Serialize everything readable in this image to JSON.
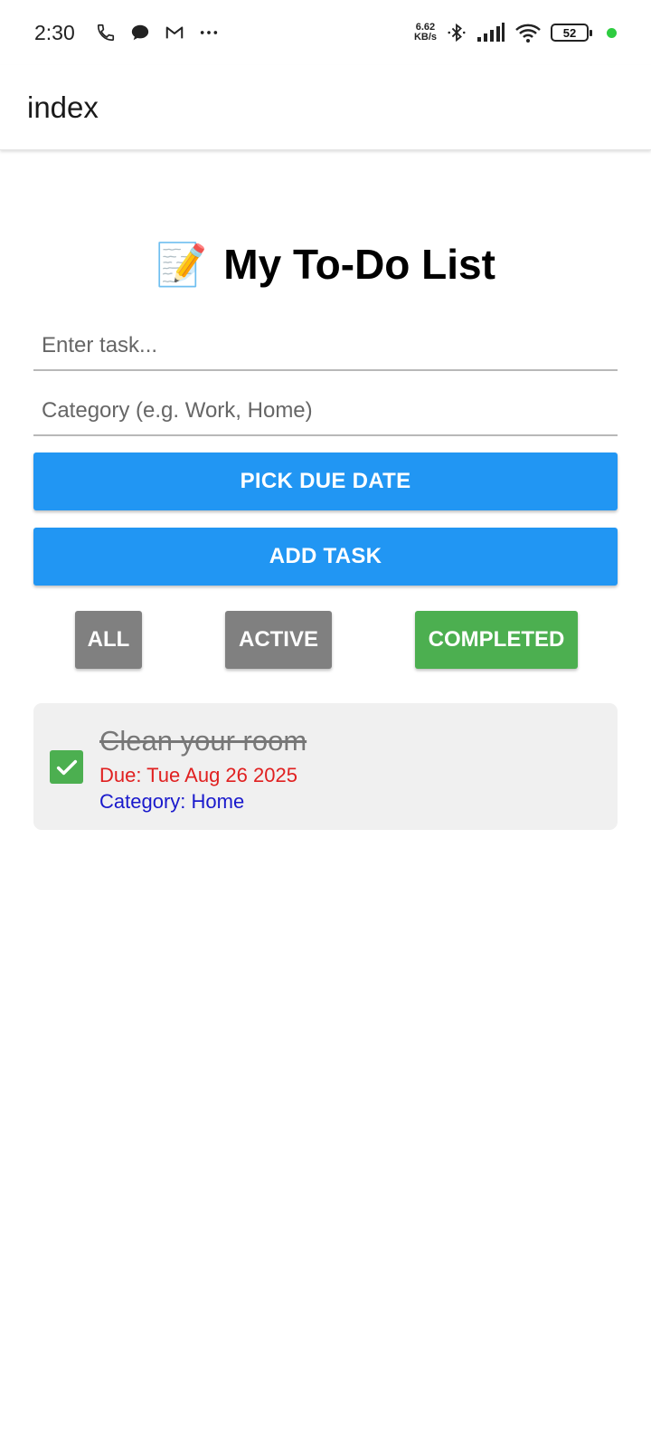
{
  "status_bar": {
    "time": "2:30",
    "net_speed_value": "6.62",
    "net_speed_unit": "KB/s",
    "battery_level": "52",
    "icons": [
      "phone-icon",
      "chat-bubble-icon",
      "gmail-icon",
      "more-dots-icon",
      "bluetooth-icon",
      "signal-icon",
      "wifi-icon",
      "battery-icon"
    ]
  },
  "app_bar": {
    "title": "index"
  },
  "page": {
    "emoji": "📝",
    "title": "My To-Do List"
  },
  "form": {
    "task_placeholder": "Enter task...",
    "task_value": "",
    "category_placeholder": "Category (e.g. Work, Home)",
    "category_value": "",
    "pick_due_date_label": "PICK DUE DATE",
    "add_task_label": "ADD TASK"
  },
  "filters": [
    {
      "label": "ALL",
      "selected": false
    },
    {
      "label": "ACTIVE",
      "selected": false
    },
    {
      "label": "COMPLETED",
      "selected": true
    }
  ],
  "tasks": [
    {
      "title": "Clean your room",
      "due": "Due: Tue Aug 26 2025",
      "category": "Category: Home",
      "completed": true
    }
  ],
  "colors": {
    "primary": "#2196f3",
    "filter_inactive": "#808080",
    "filter_selected": "#4caf50",
    "due_text": "#e02020",
    "category_text": "#1a1acc",
    "checkbox": "#4caf50"
  }
}
